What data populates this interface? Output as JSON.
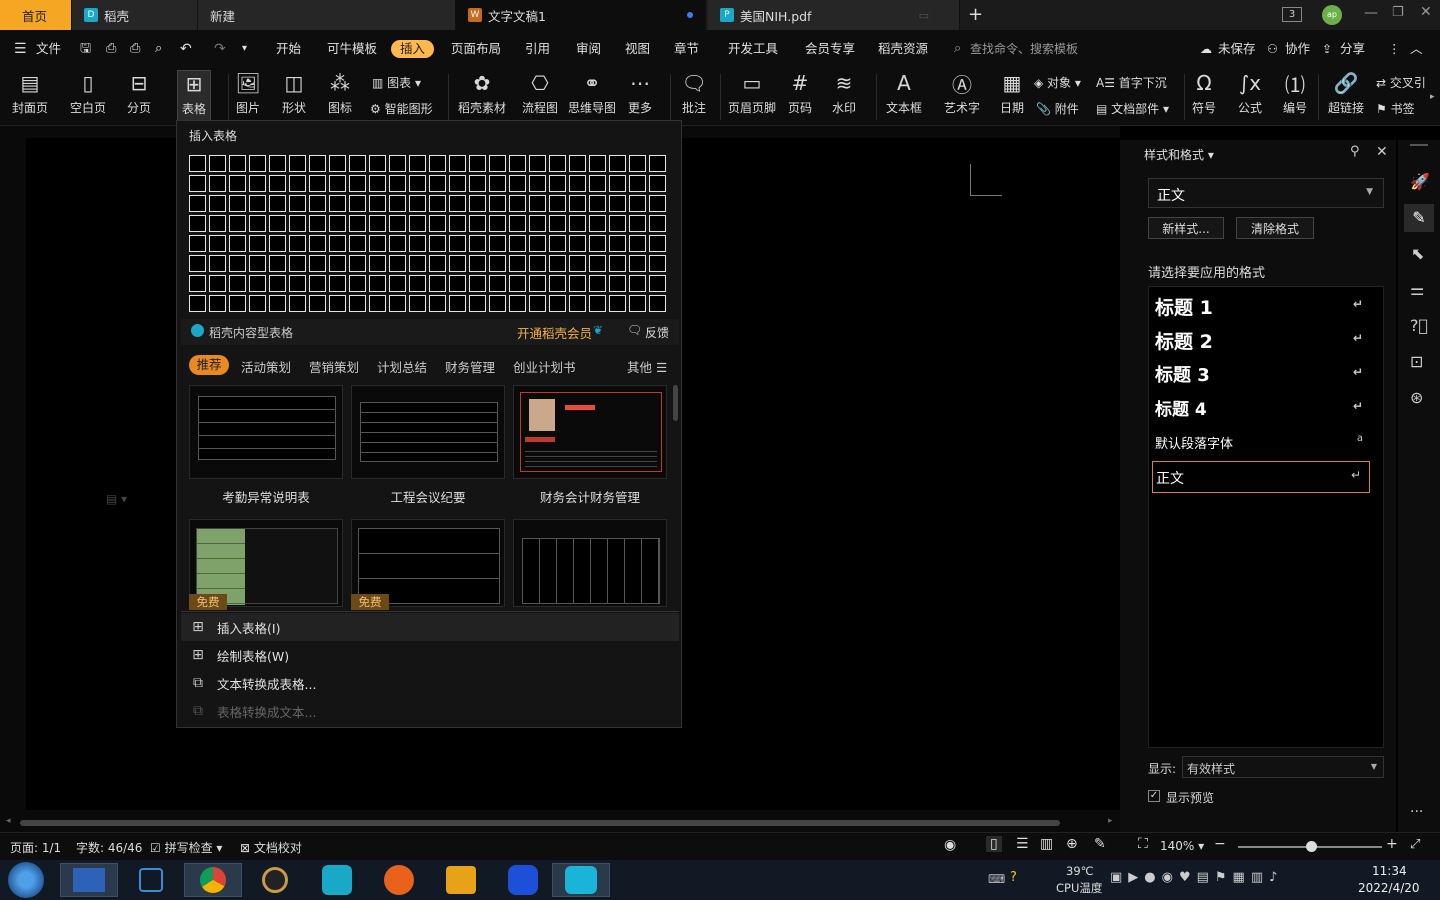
{
  "tabs": {
    "home": "首页",
    "daoke": "稻壳",
    "new": "新建",
    "doc": "文字文稿1",
    "pdf": "美国NIH.pdf",
    "badge": "3",
    "avatar": "ap"
  },
  "menu": {
    "file": "文件",
    "start": "开始",
    "cow": "可牛模板",
    "insert": "插入",
    "layout": "页面布局",
    "ref": "引用",
    "review": "审阅",
    "view": "视图",
    "chapter": "章节",
    "dev": "开发工具",
    "vip": "会员专享",
    "res": "稻壳资源",
    "search": "查找命令、搜索模板",
    "unsaved": "未保存",
    "collab": "协作",
    "share": "分享"
  },
  "ribbon": {
    "cover": "封面页",
    "blank": "空白页",
    "pagebreak": "分页",
    "table": "表格",
    "picture": "图片",
    "shape": "形状",
    "icon": "图标",
    "chart": "图表",
    "smartart": "智能图形",
    "material": "稻壳素材",
    "flow": "流程图",
    "mindmap": "思维导图",
    "more": "更多",
    "comment": "批注",
    "header": "页眉页脚",
    "pagenum": "页码",
    "watermark": "水印",
    "textbox": "文本框",
    "wordart": "艺术字",
    "date": "日期",
    "object": "对象",
    "attach": "附件",
    "dropcap": "首字下沉",
    "docpart": "文档部件",
    "symbol": "符号",
    "formula": "公式",
    "number": "编号",
    "hyperlink": "超链接",
    "crossref": "交叉引",
    "bookmark": "书签"
  },
  "dropdown": {
    "title": "插入表格",
    "daoke_table": "稻壳内容型表格",
    "vip_link": "开通稻壳会员",
    "feedback": "反馈",
    "categories": [
      "推荐",
      "活动策划",
      "营销策划",
      "计划总结",
      "财务管理",
      "创业计划书"
    ],
    "other": "其他",
    "templates": [
      "考勤异常说明表",
      "工程会议纪要",
      "财务会计财务管理"
    ],
    "free": "免费",
    "cmd_insert": "插入表格(I)",
    "cmd_draw": "绘制表格(W)",
    "cmd_text2table": "文本转换成表格...",
    "cmd_table2text": "表格转换成文本..."
  },
  "panel": {
    "title": "样式和格式",
    "current": "正文",
    "new_style": "新样式...",
    "clear": "清除格式",
    "choose": "请选择要应用的格式",
    "styles": [
      "标题 1",
      "标题 2",
      "标题 3",
      "标题 4",
      "默认段落字体",
      "正文"
    ],
    "show_label": "显示:",
    "show_value": "有效样式",
    "preview": "显示预览"
  },
  "status": {
    "page": "页面: 1/1",
    "words": "字数: 46/46",
    "spell": "拼写检查",
    "proof": "文档校对",
    "zoom": "140%"
  },
  "taskbar": {
    "temp": "39℃",
    "cpu": "CPU温度",
    "time": "11:34",
    "date": "2022/4/20"
  },
  "colors": {
    "accent": "#f5a623",
    "insert_tab": "#ffb84d",
    "vip": "#f5b042",
    "selected_border": "#e07b50"
  }
}
